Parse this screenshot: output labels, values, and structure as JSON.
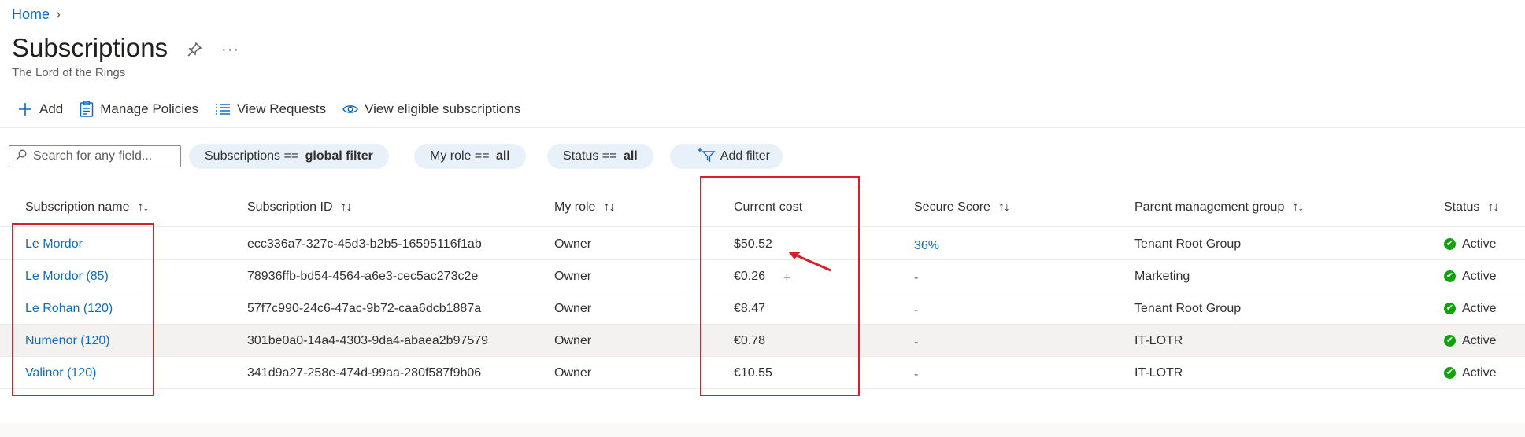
{
  "breadcrumb": {
    "home": "Home",
    "separator": "›"
  },
  "page": {
    "title": "Subscriptions",
    "subtitle": "The Lord of the Rings",
    "more": "···"
  },
  "toolbar": {
    "add": "Add",
    "manage_policies": "Manage Policies",
    "view_requests": "View Requests",
    "view_eligible": "View eligible subscriptions"
  },
  "filters": {
    "search_placeholder": "Search for any field...",
    "subscriptions": {
      "label": "Subscriptions == ",
      "value": "global filter"
    },
    "role": {
      "label": "My role == ",
      "value": "all"
    },
    "status": {
      "label": "Status == ",
      "value": "all"
    },
    "add_filter": "Add filter"
  },
  "table": {
    "headers": {
      "name": "Subscription name",
      "id": "Subscription ID",
      "role": "My role",
      "cost": "Current cost",
      "score": "Secure Score",
      "group": "Parent management group",
      "status": "Status"
    },
    "sort_glyph": "↑↓",
    "rows": [
      {
        "name": "Le Mordor",
        "id": "ecc336a7-327c-45d3-b2b5-16595116f1ab",
        "role": "Owner",
        "cost": "$50.52",
        "score": "36%",
        "group": "Tenant Root Group",
        "status": "Active"
      },
      {
        "name": "Le Mordor (85)",
        "id": "78936ffb-bd54-4564-a6e3-cec5ac273c2e",
        "role": "Owner",
        "cost": "€0.26",
        "score": "-",
        "group": "Marketing",
        "status": "Active"
      },
      {
        "name": "Le Rohan (120)",
        "id": "57f7c990-24c6-47ac-9b72-caa6dcb1887a",
        "role": "Owner",
        "cost": "€8.47",
        "score": "-",
        "group": "Tenant Root Group",
        "status": "Active"
      },
      {
        "name": "Numenor (120)",
        "id": "301be0a0-14a4-4303-9da4-abaea2b97579",
        "role": "Owner",
        "cost": "€0.78",
        "score": "-",
        "group": "IT-LOTR",
        "status": "Active"
      },
      {
        "name": "Valinor (120)",
        "id": "341d9a27-258e-474d-99aa-280f587f9b06",
        "role": "Owner",
        "cost": "€10.55",
        "score": "-",
        "group": "IT-LOTR",
        "status": "Active"
      }
    ]
  },
  "annotations": {
    "color": "#d8202c",
    "cursor_mark": "+"
  }
}
